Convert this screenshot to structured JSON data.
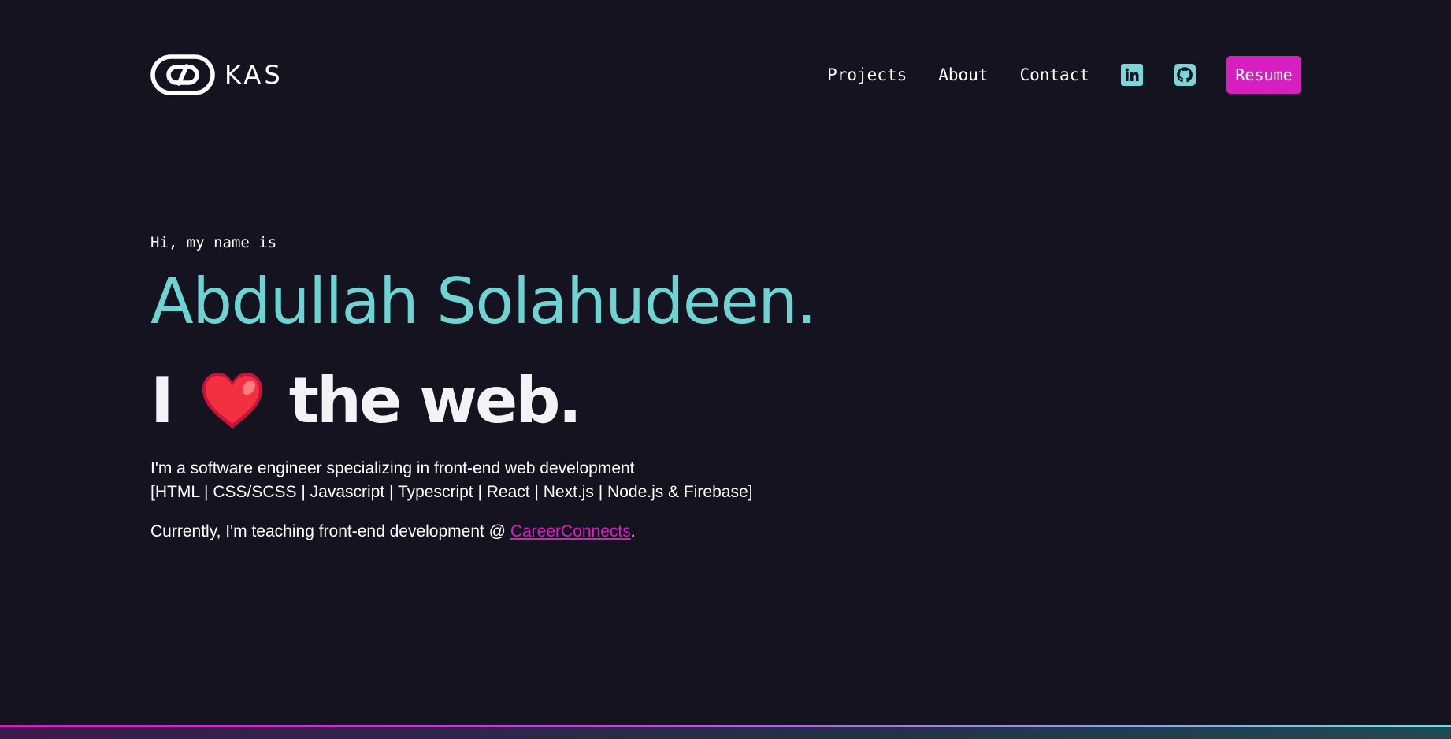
{
  "header": {
    "logo_text": "KAS",
    "nav": [
      {
        "label": "Projects"
      },
      {
        "label": "About"
      },
      {
        "label": "Contact"
      }
    ],
    "social": [
      {
        "icon": "linkedin-icon"
      },
      {
        "icon": "github-icon"
      }
    ],
    "resume_label": "Resume"
  },
  "hero": {
    "greeting": "Hi, my name is",
    "name": "Abdullah Solahudeen.",
    "tagline_prefix": "I",
    "tagline_icon": "heart-icon",
    "tagline_suffix": "the web.",
    "intro_line1": "I'm a software engineer specializing in front-end web development",
    "intro_line2": "[HTML | CSS/SCSS | Javascript | Typescript | React | Next.js | Node.js & Firebase]",
    "teaching_prefix": "Currently, I'm teaching front-end development @ ",
    "teaching_link": "CareerConnects",
    "teaching_suffix": "."
  },
  "colors": {
    "background": "#161320",
    "accent_teal": "#6fd3d3",
    "accent_magenta": "#d61ec1"
  }
}
